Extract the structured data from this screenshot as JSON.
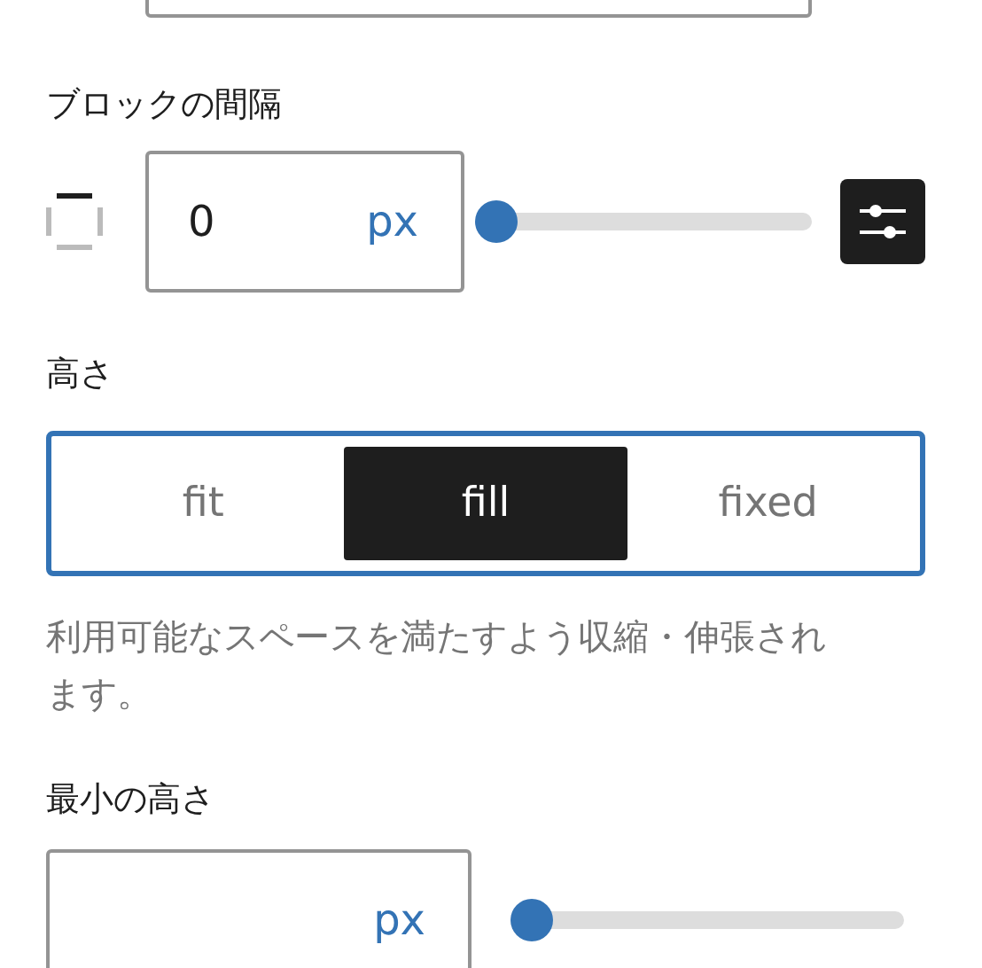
{
  "block_spacing": {
    "label": "ブロックの間隔",
    "value": "0",
    "unit": "px",
    "level": 0,
    "custom_on": true
  },
  "height": {
    "label": "高さ",
    "options": [
      {
        "label": "fit",
        "selected": false
      },
      {
        "label": "fill",
        "selected": true
      },
      {
        "label": "fixed",
        "selected": false
      }
    ],
    "help": "利用可能なスペースを満たすよう収縮・伸張されます。"
  },
  "min_height": {
    "label": "最小の高さ",
    "unit": "px",
    "level": 0
  }
}
